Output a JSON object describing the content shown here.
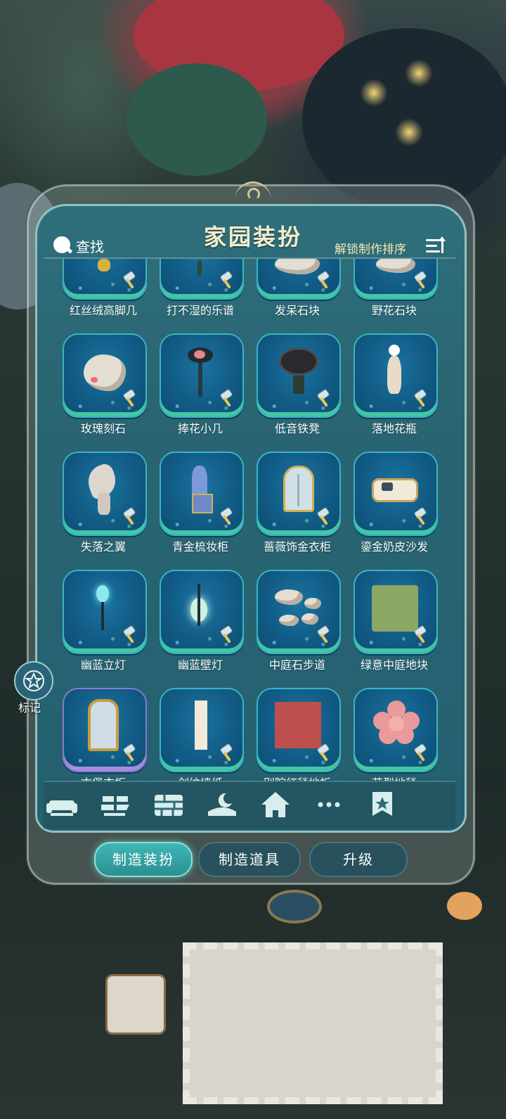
{
  "header": {
    "title": "家园装扮",
    "search_label": "查找",
    "sort_label": "解锁制作排序"
  },
  "items": [
    {
      "name": "红丝绒高脚几"
    },
    {
      "name": "打不湿的乐谱"
    },
    {
      "name": "发呆石块"
    },
    {
      "name": "野花石块"
    },
    {
      "name": "玫瑰刻石"
    },
    {
      "name": "捧花小几"
    },
    {
      "name": "低音铁凳"
    },
    {
      "name": "落地花瓶"
    },
    {
      "name": "失落之翼"
    },
    {
      "name": "青金梳妆柜"
    },
    {
      "name": "蔷薇饰金衣柜"
    },
    {
      "name": "鎏金奶皮沙发"
    },
    {
      "name": "幽蓝立灯"
    },
    {
      "name": "幽蓝壁灯"
    },
    {
      "name": "中庭石步道"
    },
    {
      "name": "绿意中庭地块"
    },
    {
      "name": "古堡衣柜"
    },
    {
      "name": "剑纹墙纸"
    },
    {
      "name": "别院红毯地板"
    },
    {
      "name": "花型地毯"
    }
  ],
  "tabs": [
    {
      "icon": "sofa-icon"
    },
    {
      "icon": "floor-tile-icon"
    },
    {
      "icon": "brick-wall-icon"
    },
    {
      "icon": "moon-lamp-icon"
    },
    {
      "icon": "house-icon"
    },
    {
      "icon": "more-icon"
    },
    {
      "icon": "favorite-star-icon"
    }
  ],
  "bottom_buttons": {
    "make_decor": "制造装扮",
    "make_props": "制造道具",
    "upgrade": "升级"
  },
  "side": {
    "mark_label": "标记"
  },
  "colors": {
    "panel": "#2a6572",
    "card": "#115c86",
    "accent_green": "#42c7a5",
    "title": "#f6ecc8",
    "active_button": "#3fb7b4"
  }
}
